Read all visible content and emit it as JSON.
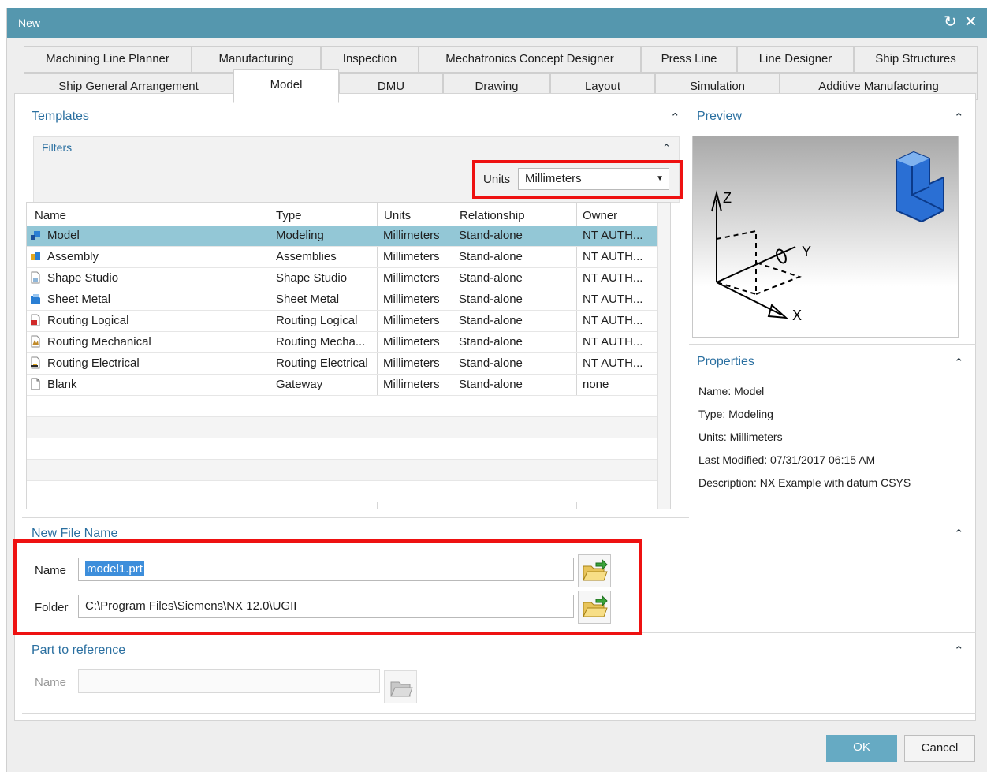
{
  "window": {
    "title": "New"
  },
  "tabs_row1": [
    {
      "label": "Machining Line Planner"
    },
    {
      "label": "Manufacturing"
    },
    {
      "label": "Inspection"
    },
    {
      "label": "Mechatronics Concept Designer"
    },
    {
      "label": "Press Line"
    },
    {
      "label": "Line Designer"
    },
    {
      "label": "Ship Structures"
    }
  ],
  "tabs_row2": [
    {
      "label": "Ship General Arrangement"
    },
    {
      "label": "Model"
    },
    {
      "label": "DMU"
    },
    {
      "label": "Drawing"
    },
    {
      "label": "Layout"
    },
    {
      "label": "Simulation"
    },
    {
      "label": "Additive Manufacturing"
    }
  ],
  "templates": {
    "title": "Templates",
    "filters_title": "Filters",
    "units_label": "Units",
    "units_value": "Millimeters",
    "columns": [
      "Name",
      "Type",
      "Units",
      "Relationship",
      "Owner"
    ],
    "rows": [
      {
        "name": "Model",
        "type": "Modeling",
        "units": "Millimeters",
        "relationship": "Stand-alone",
        "owner": "NT AUTH...",
        "icon": "model-icon"
      },
      {
        "name": "Assembly",
        "type": "Assemblies",
        "units": "Millimeters",
        "relationship": "Stand-alone",
        "owner": "NT AUTH...",
        "icon": "assembly-icon"
      },
      {
        "name": "Shape Studio",
        "type": "Shape Studio",
        "units": "Millimeters",
        "relationship": "Stand-alone",
        "owner": "NT AUTH...",
        "icon": "shape-studio-icon"
      },
      {
        "name": "Sheet Metal",
        "type": "Sheet Metal",
        "units": "Millimeters",
        "relationship": "Stand-alone",
        "owner": "NT AUTH...",
        "icon": "sheet-metal-icon"
      },
      {
        "name": "Routing Logical",
        "type": "Routing Logical",
        "units": "Millimeters",
        "relationship": "Stand-alone",
        "owner": "NT AUTH...",
        "icon": "routing-logical-icon"
      },
      {
        "name": "Routing Mechanical",
        "type": "Routing Mecha...",
        "units": "Millimeters",
        "relationship": "Stand-alone",
        "owner": "NT AUTH...",
        "icon": "routing-mechanical-icon"
      },
      {
        "name": "Routing Electrical",
        "type": "Routing Electrical",
        "units": "Millimeters",
        "relationship": "Stand-alone",
        "owner": "NT AUTH...",
        "icon": "routing-electrical-icon"
      },
      {
        "name": "Blank",
        "type": "Gateway",
        "units": "Millimeters",
        "relationship": "Stand-alone",
        "owner": "none",
        "icon": "blank-document-icon"
      }
    ]
  },
  "preview": {
    "title": "Preview",
    "axis_z": "Z",
    "axis_y": "Y",
    "axis_x": "X"
  },
  "properties": {
    "title": "Properties",
    "name": "Name: Model",
    "type": "Type: Modeling",
    "units": "Units: Millimeters",
    "last_modified": "Last Modified: 07/31/2017 06:15 AM",
    "description": "Description: NX Example with datum CSYS"
  },
  "new_file": {
    "title": "New File Name",
    "name_label": "Name",
    "name_value": "model1.prt",
    "folder_label": "Folder",
    "folder_value": "C:\\Program Files\\Siemens\\NX 12.0\\UGII"
  },
  "part_ref": {
    "title": "Part to reference",
    "name_label": "Name",
    "name_value": ""
  },
  "buttons": {
    "ok": "OK",
    "cancel": "Cancel"
  },
  "colors": {
    "titlebar": "#5597ae",
    "accent_text": "#2a6fa0",
    "selection": "#93c7d6",
    "highlight_box": "#ee1111",
    "ok_button": "#66aac3"
  }
}
